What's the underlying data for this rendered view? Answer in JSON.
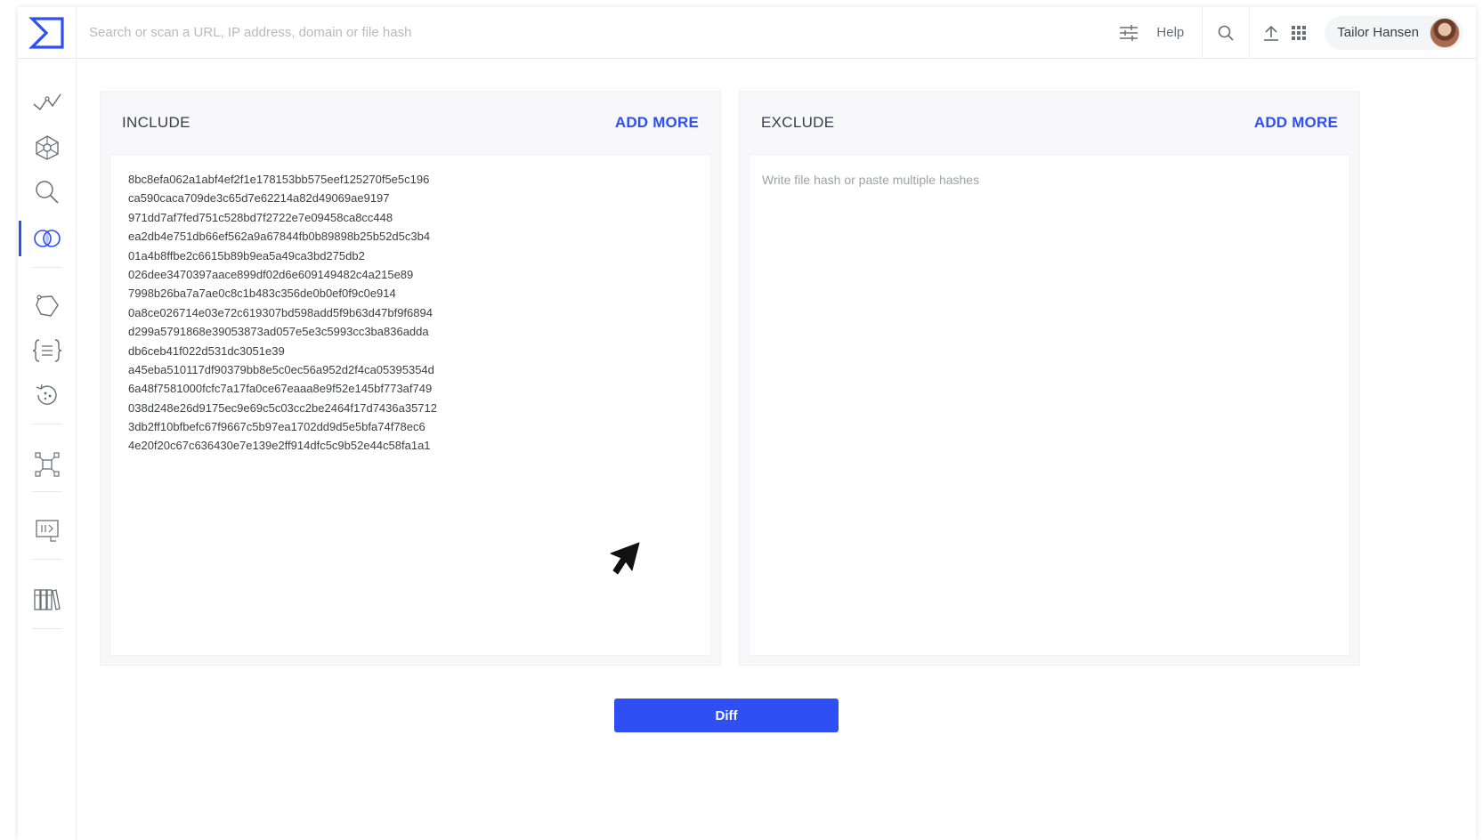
{
  "header": {
    "search_placeholder": "Search or scan a URL, IP address, domain or file hash",
    "help_label": "Help",
    "user_name": "Tailor Hansen"
  },
  "include_panel": {
    "title": "INCLUDE",
    "add_more_label": "ADD MORE",
    "hashes": [
      "8bc8efa062a1abf4ef2f1e178153bb575eef125270f5e5c196",
      "ca590caca709de3c65d7e62214a82d49069ae9197",
      "971dd7af7fed751c528bd7f2722e7e09458ca8cc448",
      "ea2db4e751db66ef562a9a67844fb0b89898b25b52d5c3b4",
      "01a4b8ffbe2c6615b89b9ea5a49ca3bd275db2",
      "026dee3470397aace899df02d6e609149482c4a215e89",
      "7998b26ba7a7ae0c8c1b483c356de0b0ef0f9c0e914",
      "0a8ce026714e03e72c619307bd598add5f9b63d47bf9f6894",
      "d299a5791868e39053873ad057e5e3c5993cc3ba836adda",
      "db6ceb41f022d531dc3051e39",
      "a45eba510117df90379bb8e5c0ec56a952d2f4ca05395354d",
      "6a48f7581000fcfc7a17fa0ce67eaaa8e9f52e145bf773af749",
      "038d248e26d9175ec9e69c5c03cc2be2464f17d7436a35712",
      "3db2ff10bfbefc67f9667c5b97ea1702dd9d5e5bfa74f78ec6",
      "4e20f20c67c636430e7e139e2ff914dfc5c9b52e44c58fa1a1"
    ]
  },
  "exclude_panel": {
    "title": "EXCLUDE",
    "add_more_label": "ADD MORE",
    "placeholder": "Write file hash or paste multiple hashes"
  },
  "actions": {
    "diff_label": "Diff"
  },
  "colors": {
    "accent": "#2f4ff2"
  },
  "sidebar": {
    "items": [
      {
        "icon": "trend-icon"
      },
      {
        "icon": "hexagon-network-icon"
      },
      {
        "icon": "search-icon"
      },
      {
        "icon": "diff-circles-icon",
        "active": true
      },
      {
        "icon": "hunt-icon"
      },
      {
        "icon": "rules-brackets-icon"
      },
      {
        "icon": "retrohunt-icon"
      },
      {
        "icon": "graph-icon"
      },
      {
        "icon": "translate-icon"
      },
      {
        "icon": "library-icon"
      }
    ]
  }
}
